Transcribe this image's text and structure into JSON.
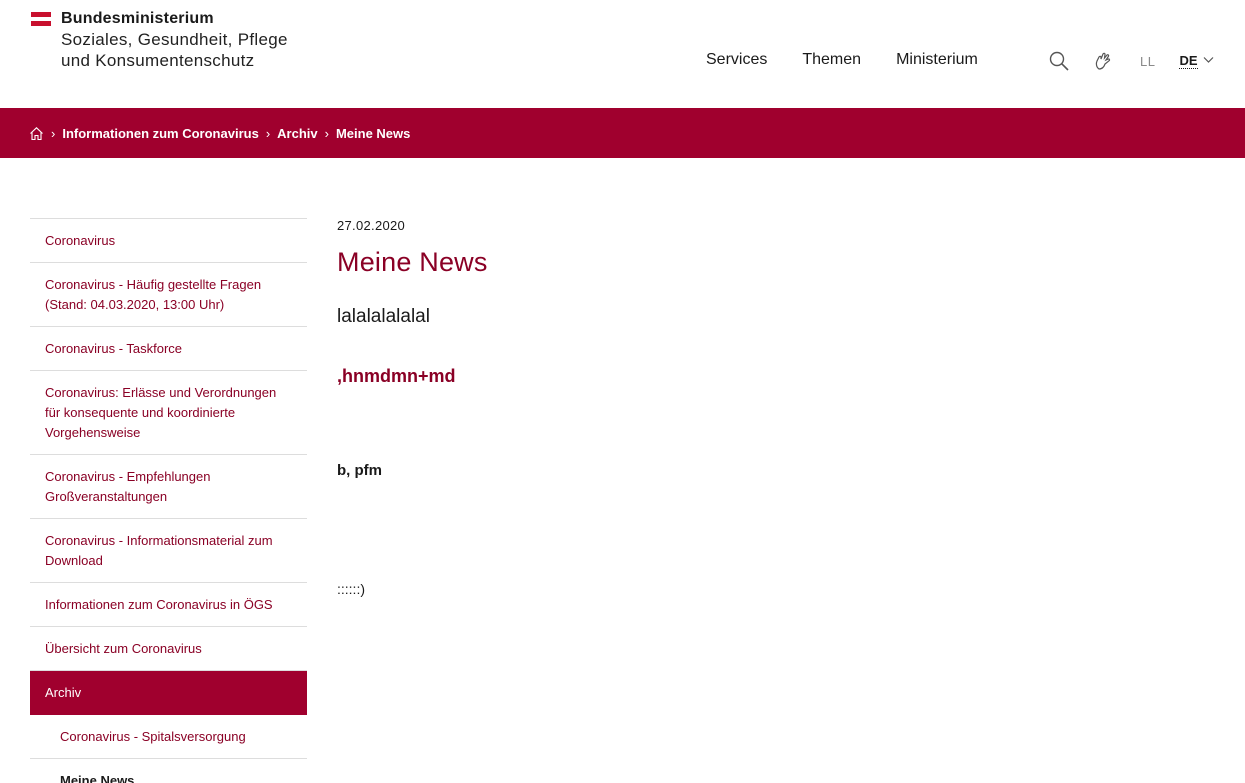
{
  "header": {
    "logo_line1": "Bundesministerium",
    "logo_line2": "Soziales, Gesundheit, Pflege",
    "logo_line3": "und Konsumentenschutz",
    "nav": [
      "Services",
      "Themen",
      "Ministerium"
    ],
    "easy_language": "LL",
    "language": "DE",
    "icons": [
      "search-icon",
      "sign-language-icon",
      "chevron-down-icon"
    ]
  },
  "breadcrumb": {
    "icon": "home-icon",
    "items": [
      "Informationen zum Coronavirus",
      "Archiv",
      "Meine News"
    ]
  },
  "sidebar": {
    "items": [
      "Coronavirus",
      "Coronavirus - Häufig gestellte Fragen (Stand: 04.03.2020, 13:00 Uhr)",
      "Coronavirus - Taskforce",
      "Coronavirus: Erlässe und Verordnungen für konsequente und koordinierte Vorgehensweise",
      "Coronavirus - Empfehlungen Großveranstaltungen",
      "Coronavirus - Informationsmaterial zum Download",
      "Informationen zum Coronavirus in ÖGS",
      "Übersicht zum Coronavirus",
      "Archiv",
      "Coronavirus - Spitalsversorgung",
      "Meine News"
    ]
  },
  "article": {
    "date": "27.02.2020",
    "title": "Meine News",
    "paragraph1": "lalalalalalal",
    "heading2": ",hnmdmn+md",
    "heading3": "b, pfm",
    "paragraph2": "::::::)"
  },
  "colors": {
    "brand": "#a0002e",
    "link": "#8a0025",
    "flag_red": "#c8102e"
  }
}
